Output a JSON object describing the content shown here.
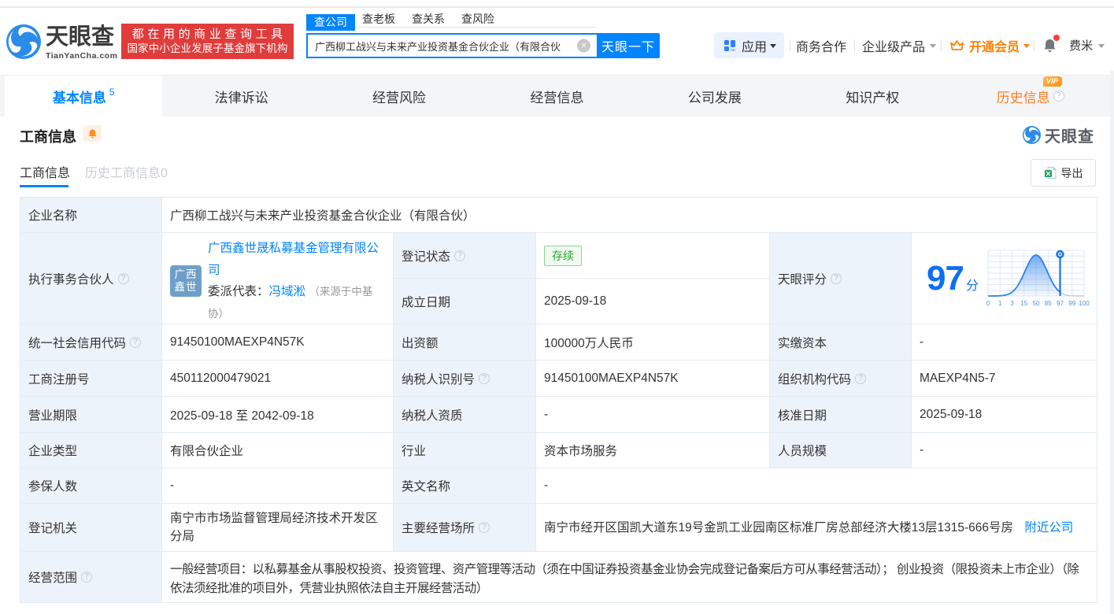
{
  "topnav": {
    "logo_title": "天眼查",
    "logo_domain": "TianYanCha.com",
    "promo_line1": "都在用的商业查询工具",
    "promo_line2": "国家中小企业发展子基金旗下机构",
    "search": {
      "tabs": [
        {
          "label": "查公司"
        },
        {
          "label": "查老板"
        },
        {
          "label": "查关系"
        },
        {
          "label": "查风险"
        }
      ],
      "value": "广西柳工战兴与未来产业投资基金合伙企业（有限合伙",
      "button": "天眼一下"
    },
    "menu": {
      "apps": "应用",
      "cooperation": "商务合作",
      "enterprise": "企业级产品",
      "vip": "开通会员",
      "user": "费米"
    }
  },
  "nav_tabs": [
    {
      "label": "基本信息",
      "count": "5"
    },
    {
      "label": "法律诉讼"
    },
    {
      "label": "经营风险"
    },
    {
      "label": "经营信息"
    },
    {
      "label": "公司发展"
    },
    {
      "label": "知识产权"
    },
    {
      "label": "历史信息",
      "vip": "VIP"
    }
  ],
  "section": {
    "title": "工商信息",
    "subtab_active": "工商信息",
    "subtab_history": "历史工商信息0",
    "export_label": "导出",
    "watermark": "天眼查"
  },
  "table": {
    "company_name": {
      "label": "企业名称",
      "value": "广西柳工战兴与未来产业投资基金合伙企业（有限合伙）"
    },
    "partner": {
      "label": "执行事务合伙人",
      "logo_line1": "广西",
      "logo_line2": "鑫世",
      "company": "广西鑫世晟私募基金管理有限公司",
      "rep_label": "委派代表：",
      "rep_name": "冯域淞",
      "rep_source": "（来源于中基协）"
    },
    "reg_status": {
      "label": "登记状态",
      "value": "存续"
    },
    "est_date": {
      "label": "成立日期",
      "value": "2025-09-18"
    },
    "score": {
      "label": "天眼评分",
      "value": "97",
      "unit": "分"
    },
    "credit_code": {
      "label": "统一社会信用代码",
      "value": "91450100MAEXP4N57K"
    },
    "capital": {
      "label": "出资额",
      "value": "100000万人民币"
    },
    "paid_capital": {
      "label": "实缴资本",
      "value": "-"
    },
    "reg_number": {
      "label": "工商注册号",
      "value": "450112000479021"
    },
    "tax_id": {
      "label": "纳税人识别号",
      "value": "91450100MAEXP4N57K"
    },
    "org_code": {
      "label": "组织机构代码",
      "value": "MAEXP4N5-7"
    },
    "business_term": {
      "label": "营业期限",
      "value": "2025-09-18 至 2042-09-18"
    },
    "tax_qualification": {
      "label": "纳税人资质",
      "value": "-"
    },
    "approval_date": {
      "label": "核准日期",
      "value": "2025-09-18"
    },
    "company_type": {
      "label": "企业类型",
      "value": "有限合伙企业"
    },
    "industry": {
      "label": "行业",
      "value": "资本市场服务"
    },
    "staff_size": {
      "label": "人员规模",
      "value": "-"
    },
    "insured_count": {
      "label": "参保人数",
      "value": "-"
    },
    "english_name": {
      "label": "英文名称",
      "value": "-"
    },
    "reg_authority": {
      "label": "登记机关",
      "value": "南宁市市场监督管理局经济技术开发区分局"
    },
    "business_address": {
      "label": "主要经营场所",
      "value": "南宁市经开区国凯大道东19号金凯工业园南区标准厂房总部经济大楼13层1315-666号房",
      "link": "附近公司"
    },
    "business_scope": {
      "label": "经营范围",
      "value": "一般经营项目：以私募基金从事股权投资、投资管理、资产管理等活动（须在中国证券投资基金业协会完成登记备案后方可从事经营活动）； 创业投资（限投资未上市企业）（除依法须经批准的项目外，凭营业执照依法自主开展经营活动）"
    }
  },
  "score_chart": {
    "type": "area",
    "title": "天眼评分",
    "score": 97,
    "score_unit": "分",
    "x_labels": [
      "0",
      "1",
      "3",
      "15",
      "50",
      "85",
      "97",
      "99",
      "100"
    ],
    "peak_label": "50",
    "pin_label": "97",
    "curve_color": "#2d7ff0",
    "tail_color": "#c9ced8",
    "grid_color": "#dce8f6",
    "label_color": "#4a90e2"
  },
  "colors": {
    "brand_blue": "#0084ff",
    "promo_red": "#e03c3c",
    "vip_orange": "#ff8000",
    "status_green": "#2aa62e"
  }
}
